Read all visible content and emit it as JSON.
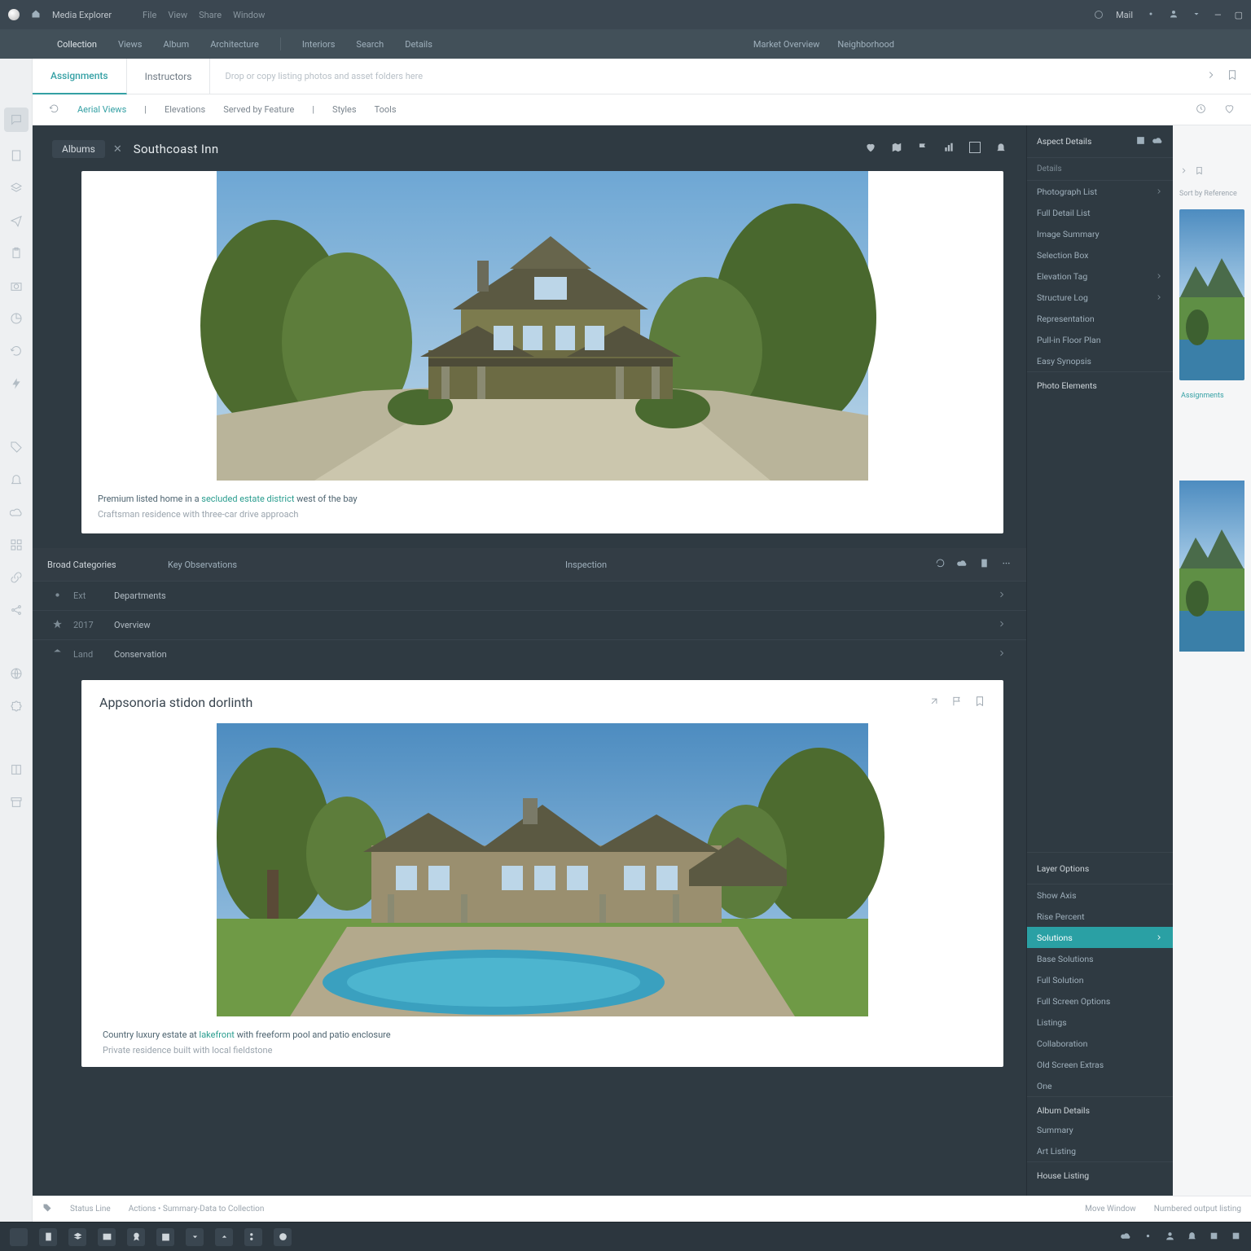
{
  "titlebar": {
    "left": "Media Explorer",
    "segments": [
      "File",
      "View",
      "Share",
      "Window"
    ],
    "right_link": "Mail",
    "right_download": "",
    "frame": ""
  },
  "navbar": {
    "items": [
      "Collection",
      "Views",
      "Album",
      "Architecture",
      "Interiors",
      "Search",
      "Details"
    ],
    "selected": 0,
    "center": [
      "Market Overview",
      "Neighborhood"
    ]
  },
  "tabs": {
    "items": [
      "Assignments",
      "Instructors"
    ],
    "active": 0,
    "hint": "Drop or copy listing photos and asset folders here"
  },
  "filters": {
    "items": [
      "Aerial Views",
      "Elevations",
      "Served by Feature",
      "Styles",
      "Tools"
    ],
    "selected": 0
  },
  "cards_header": {
    "pill": "Albums",
    "x": "✕",
    "title": "Southcoast Inn",
    "icons": [
      "heart",
      "map",
      "flag",
      "chart",
      "square",
      "bell"
    ]
  },
  "card1": {
    "caption_line1_a": "Premium listed home in a ",
    "caption_line1_b": "secluded estate district",
    "caption_line1_c": " west of the bay",
    "caption_line2": "Craftsman residence with three-car drive approach"
  },
  "midbar": {
    "left": "Broad Categories",
    "rest": "Key Observations",
    "option": "Inspection"
  },
  "proprows": [
    {
      "label": "Ext",
      "text": "Departments"
    },
    {
      "label": "2017",
      "text": "Overview"
    },
    {
      "label": "Land",
      "text": "Conservation"
    }
  ],
  "card2": {
    "title": "Appsonoria stidon dorlinth",
    "caption_line1_a": "Country luxury estate at ",
    "caption_line1_b": "lakefront",
    "caption_line1_c": " with freeform pool and patio enclosure",
    "caption_line2": "Private residence built with local fieldstone"
  },
  "inspector": {
    "header": "Aspect Details",
    "icons": [
      "box",
      "cloud"
    ],
    "sub": "Details",
    "group1": [
      "Photograph List",
      "Full Detail List",
      "Image Summary",
      "Selection Box",
      "Elevation Tag",
      "Structure Log",
      "Representation",
      "Pull-in Floor Plan",
      "Easy Synopsis"
    ],
    "group2_title": "Photo Elements",
    "lower_header": "Layer Options",
    "group3": [
      "Show Axis",
      "Rise Percent",
      "Solutions",
      "Base Solutions"
    ],
    "group3_selected": 2,
    "group4": [
      "Full Solution",
      "Full Screen Options",
      "Listings",
      "Collaboration",
      "Old Screen Extras",
      "One"
    ],
    "group5_title": "Album Details",
    "group5": [
      "Summary",
      "Art Listing"
    ],
    "group6_title": "House Listing"
  },
  "thumbs": {
    "header": "Sort by Reference",
    "label": "Assignments"
  },
  "bottombar": {
    "left_a": "Status Line",
    "left_b": "Actions • Summary-Data to Collection",
    "right_a": "Move Window",
    "right_b": "Numbered output listing"
  }
}
